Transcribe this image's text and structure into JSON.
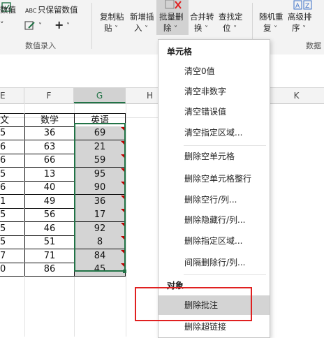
{
  "ribbon": {
    "left_partial": "数值",
    "keep_values": "只保留数值",
    "abc_label": "ABC",
    "plus_label": "+",
    "buttons": [
      {
        "line1": "复制粘",
        "line2": "贴"
      },
      {
        "line1": "新增插",
        "line2": "入"
      },
      {
        "line1": "批量删",
        "line2": "除"
      },
      {
        "line1": "合并转",
        "line2": "换"
      },
      {
        "line1": "查找定",
        "line2": "位"
      },
      {
        "line1": "随机重",
        "line2": "复"
      },
      {
        "line1": "高级排",
        "line2": "序"
      }
    ],
    "group_data_entry": "数值录入",
    "group_right_partial": "数据"
  },
  "columns": [
    "E",
    "F",
    "G",
    "H",
    "K"
  ],
  "table": {
    "header": [
      "文",
      "数学",
      "英语"
    ],
    "rows": [
      [
        "5",
        "36",
        "69"
      ],
      [
        "6",
        "63",
        "21"
      ],
      [
        "6",
        "66",
        "59"
      ],
      [
        "5",
        "13",
        "95"
      ],
      [
        "6",
        "40",
        "90"
      ],
      [
        "1",
        "49",
        "36"
      ],
      [
        "5",
        "56",
        "17"
      ],
      [
        "5",
        "46",
        "92"
      ],
      [
        "5",
        "51",
        "8"
      ],
      [
        "7",
        "71",
        "84"
      ],
      [
        "0",
        "86",
        "45"
      ]
    ]
  },
  "menu": {
    "section_cells": "单元格",
    "cell_items": [
      "清空0值",
      "清空非数字",
      "清空错误值",
      "清空指定区域..."
    ],
    "delete_items": [
      "删除空单元格",
      "删除空单元格整行",
      "删除空行/列...",
      "删除隐藏行/列...",
      "删除指定区域...",
      "间隔删除行/列..."
    ],
    "section_objects": "对象",
    "object_items": [
      "删除批注",
      "删除超链接"
    ]
  },
  "colors": {
    "accent": "#217346",
    "highlight_box": "#e02020",
    "comment_marker": "#c00000"
  }
}
